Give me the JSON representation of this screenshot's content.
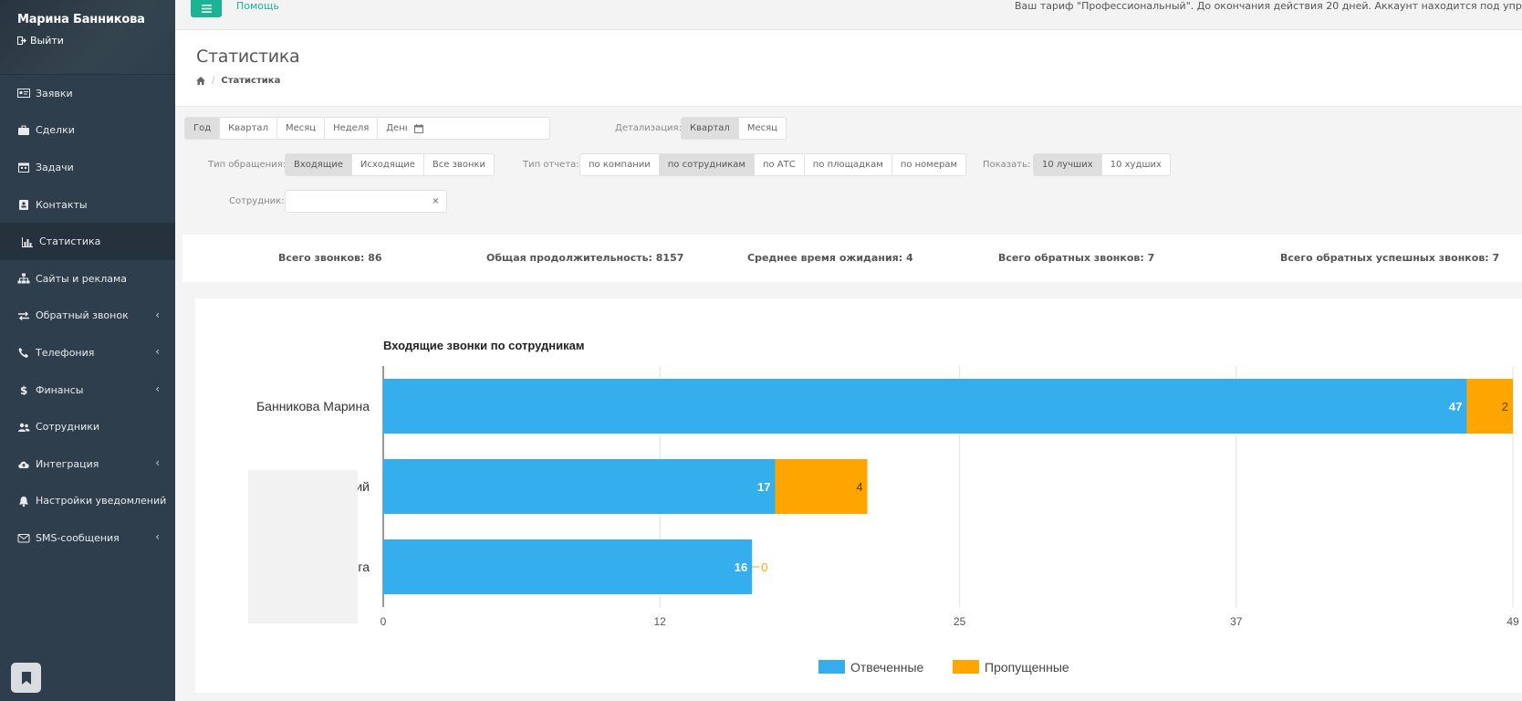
{
  "user": {
    "name": "Марина Банникова",
    "logout": "Выйти"
  },
  "sidebar": {
    "items": [
      {
        "label": "Заявки",
        "icon": "id-card-icon",
        "name": "sidebar-item-requests",
        "chevron": false
      },
      {
        "label": "Сделки",
        "icon": "briefcase-icon",
        "name": "sidebar-item-deals",
        "chevron": false
      },
      {
        "label": "Задачи",
        "icon": "calendar-icon",
        "name": "sidebar-item-tasks",
        "chevron": false
      },
      {
        "label": "Контакты",
        "icon": "address-book-icon",
        "name": "sidebar-item-contacts",
        "chevron": false
      },
      {
        "label": "Статистика",
        "icon": "bar-chart-icon",
        "name": "sidebar-item-statistics",
        "chevron": false,
        "active": true
      },
      {
        "label": "Сайты и реклама",
        "icon": "sitemap-icon",
        "name": "sidebar-item-sites",
        "chevron": false
      },
      {
        "label": "Обратный звонок",
        "icon": "exchange-icon",
        "name": "sidebar-item-callback",
        "chevron": true
      },
      {
        "label": "Телефония",
        "icon": "phone-icon",
        "name": "sidebar-item-telephony",
        "chevron": true
      },
      {
        "label": "Финансы",
        "icon": "dollar-icon",
        "name": "sidebar-item-finance",
        "chevron": true
      },
      {
        "label": "Сотрудники",
        "icon": "users-icon",
        "name": "sidebar-item-employees",
        "chevron": false
      },
      {
        "label": "Интеграция",
        "icon": "cloud-upload-icon",
        "name": "sidebar-item-integration",
        "chevron": true
      },
      {
        "label": "Настройки уведомлений",
        "icon": "bell-icon",
        "name": "sidebar-item-notifications",
        "chevron": false
      },
      {
        "label": "SMS-сообщения",
        "icon": "envelope-icon",
        "name": "sidebar-item-sms",
        "chevron": true
      }
    ]
  },
  "topbar": {
    "help": "Помощь",
    "tariff": "Ваш тариф \"Профессиональный\". До окончания действия 20 дней. Аккаунт находится под управлением \"Hote"
  },
  "page": {
    "title": "Статистика",
    "breadcrumb": "Статистика"
  },
  "filters": {
    "period": [
      "Год",
      "Квартал",
      "Месяц",
      "Неделя",
      "День"
    ],
    "period_selected": "Год",
    "detail_label": "Детализация:",
    "detail": [
      "Квартал",
      "Месяц"
    ],
    "detail_selected": "Квартал",
    "call_type_label": "Тип обращения:",
    "call_type": [
      "Входящие",
      "Исходящие",
      "Все звонки"
    ],
    "call_type_selected": "Входящие",
    "report_type_label": "Тип отчета:",
    "report_type": [
      "по компании",
      "по сотрудникам",
      "по АТС",
      "по площадкам",
      "по номерам"
    ],
    "report_type_selected": "по сотрудникам",
    "show_label": "Показать:",
    "show": [
      "10 лучших",
      "10 худших"
    ],
    "show_selected": "10 лучших",
    "employee_label": "Сотрудник:",
    "employee_value": "",
    "clear": "×"
  },
  "summary": {
    "total_calls": "Всего звонков: 86",
    "total_duration": "Общая продолжительность: 8157",
    "avg_wait": "Среднее время ожидания: 4",
    "total_callbacks": "Всего обратных звонков: 7",
    "total_callbacks_success": "Всего обратных успешных звонков: 7"
  },
  "chart_data": {
    "type": "bar",
    "orientation": "horizontal",
    "stacked": true,
    "title": "Входящие звонки по сотрудникам",
    "categories": [
      "Банникова Марина",
      "ий",
      "га"
    ],
    "series": [
      {
        "name": "Отвеченные",
        "values": [
          47,
          17,
          16
        ],
        "color": "#35aeed"
      },
      {
        "name": "Пропущенные",
        "values": [
          2,
          4,
          0
        ],
        "color": "#ffa500"
      }
    ],
    "x_ticks": [
      0,
      12,
      25,
      37,
      49
    ],
    "xlim": [
      0,
      49
    ],
    "grid": true,
    "legend": "bottom"
  }
}
